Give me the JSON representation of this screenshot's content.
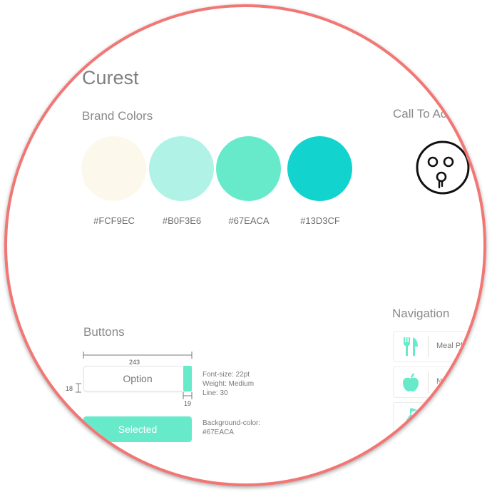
{
  "title": "Curest",
  "brand_colors": {
    "heading": "Brand Colors",
    "swatches": [
      {
        "hex": "#FCF9EC",
        "label": "#FCF9EC"
      },
      {
        "hex": "#B0F3E6",
        "label": "#B0F3E6"
      },
      {
        "hex": "#67EACA",
        "label": "#67EACA"
      },
      {
        "hex": "#13D3CF",
        "label": "#13D3CF"
      }
    ]
  },
  "call_to_action": {
    "heading": "Call To Ac"
  },
  "navigation": {
    "heading": "Navigation",
    "items": [
      {
        "label": "Meal Plan",
        "icon": "fork-knife-icon"
      },
      {
        "label": "Nutr",
        "icon": "apple-icon"
      },
      {
        "label": "",
        "icon": "mountain-flag-icon"
      }
    ]
  },
  "buttons": {
    "heading": "Buttons",
    "width_label": "243",
    "height_label": "18",
    "tab_width_label": "19",
    "option_label": "Option",
    "selected_label": "Selected",
    "spec_font": "Font-size: 22pt",
    "spec_weight": "Weight: Medium",
    "spec_line": "Line: 30",
    "spec_bg_label": "Background-color:",
    "spec_bg_value": "#67EACA"
  },
  "colors": {
    "accent": "#67EACA",
    "ring": "#F27774",
    "icon": "#67EACA"
  }
}
